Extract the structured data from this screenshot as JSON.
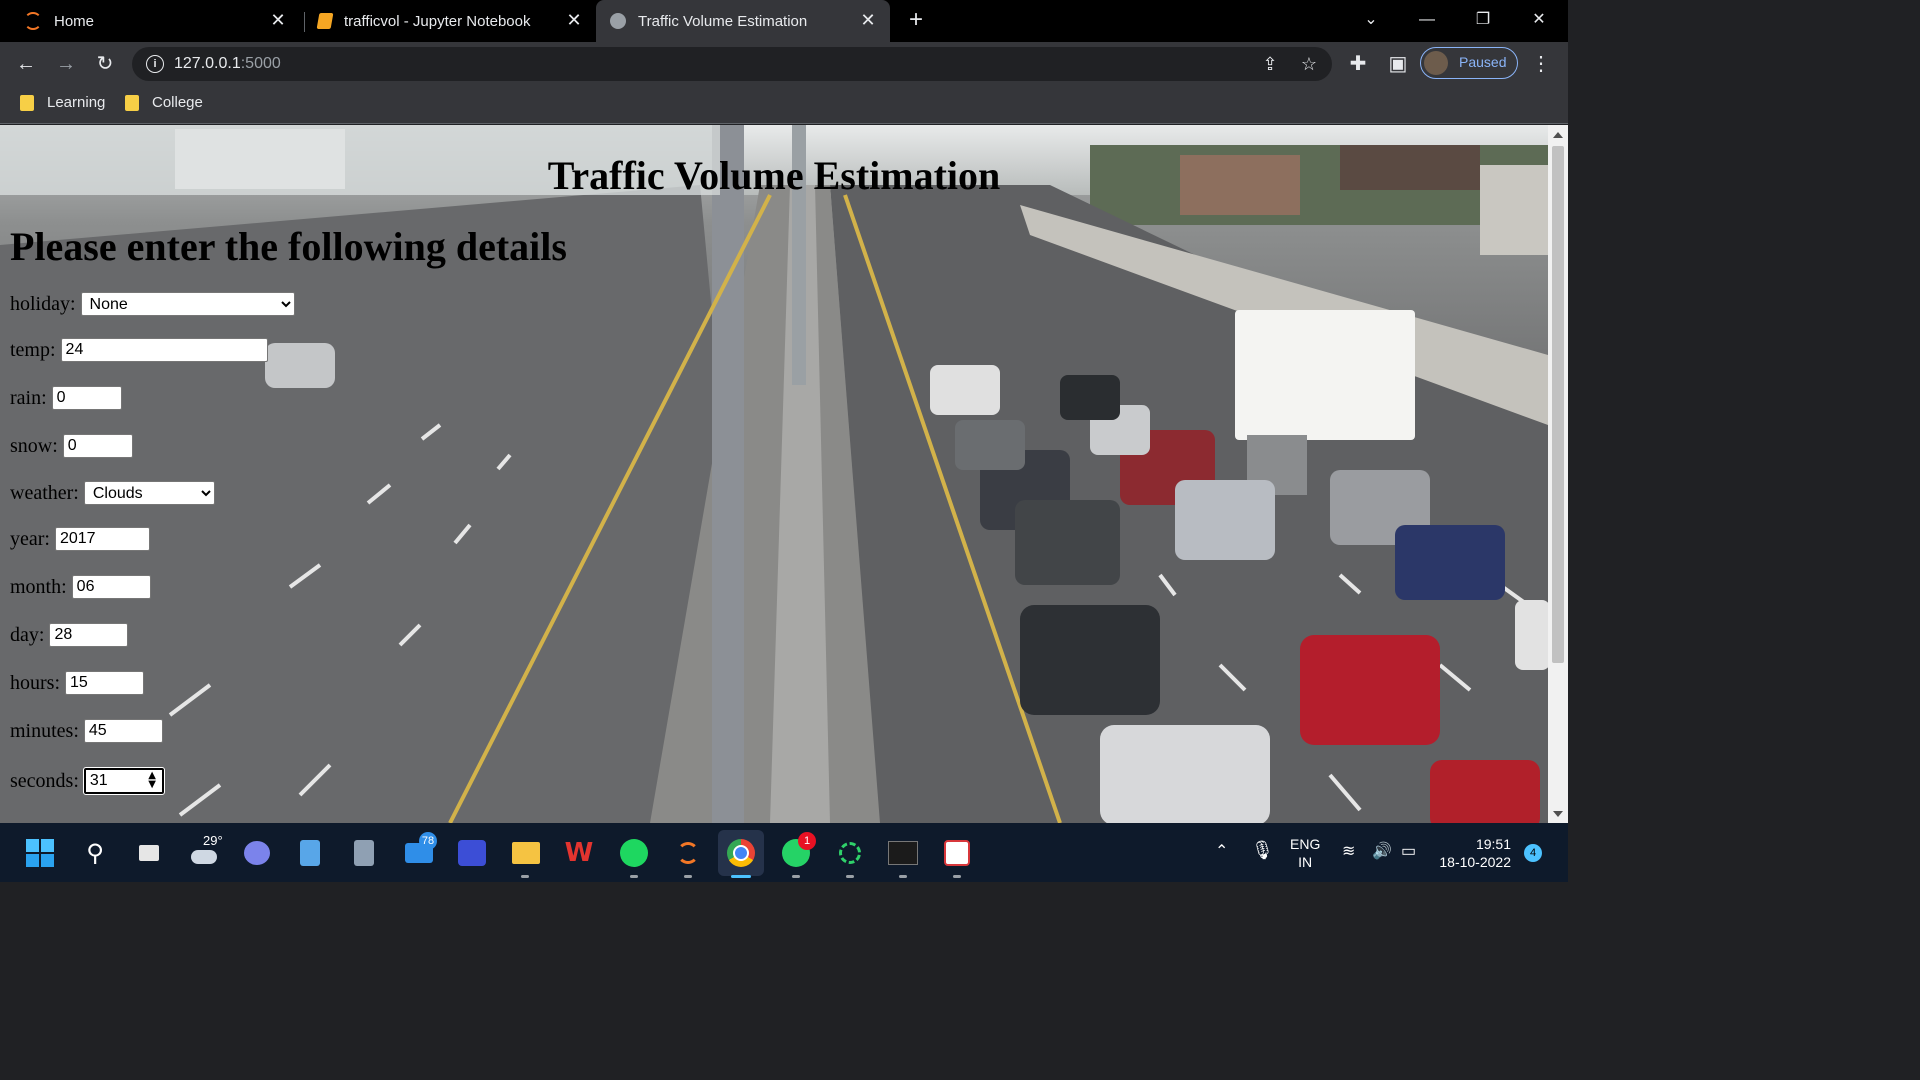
{
  "browser": {
    "tabs": [
      {
        "title": "Home",
        "icon": "spinner-orange-icon",
        "active": false
      },
      {
        "title": "trafficvol - Jupyter Notebook",
        "icon": "notebook-icon",
        "active": false
      },
      {
        "title": "Traffic Volume Estimation",
        "icon": "globe-icon",
        "active": true
      }
    ],
    "url_host": "127.0.0.1",
    "url_port": ":5000",
    "profile_label": "Paused",
    "bookmarks": [
      "Learning",
      "College"
    ]
  },
  "page": {
    "title": "Traffic Volume Estimation",
    "heading": "Please enter the following details",
    "form": {
      "holiday": {
        "label": "holiday:",
        "value": "None"
      },
      "temp": {
        "label": "temp:",
        "value": "24"
      },
      "rain": {
        "label": "rain:",
        "value": "0"
      },
      "snow": {
        "label": "snow:",
        "value": "0"
      },
      "weather": {
        "label": "weather:",
        "value": "Clouds"
      },
      "year": {
        "label": "year:",
        "value": "2017"
      },
      "month": {
        "label": "month:",
        "value": "06"
      },
      "day": {
        "label": "day:",
        "value": "28"
      },
      "hours": {
        "label": "hours:",
        "value": "15"
      },
      "minutes": {
        "label": "minutes:",
        "value": "45"
      },
      "seconds": {
        "label": "seconds:",
        "value": "31"
      }
    }
  },
  "taskbar": {
    "weather_temp": "29°",
    "mail_badge": "78",
    "whatsapp_badge": "1",
    "lang_top": "ENG",
    "lang_bottom": "IN",
    "time": "19:51",
    "date": "18-10-2022",
    "notification_count": "4"
  },
  "colors": {
    "accent": "#8ab4f8",
    "tab_active": "#35363a",
    "taskbar": "#0e1a2b"
  }
}
